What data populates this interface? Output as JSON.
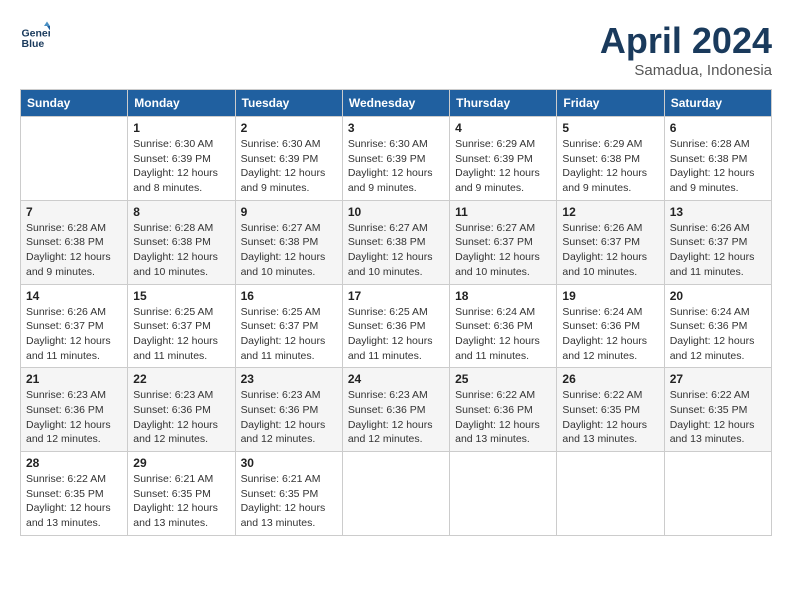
{
  "header": {
    "logo_line1": "General",
    "logo_line2": "Blue",
    "month": "April 2024",
    "location": "Samadua, Indonesia"
  },
  "weekdays": [
    "Sunday",
    "Monday",
    "Tuesday",
    "Wednesday",
    "Thursday",
    "Friday",
    "Saturday"
  ],
  "weeks": [
    [
      {
        "day": "",
        "sunrise": "",
        "sunset": "",
        "daylight": ""
      },
      {
        "day": "1",
        "sunrise": "Sunrise: 6:30 AM",
        "sunset": "Sunset: 6:39 PM",
        "daylight": "Daylight: 12 hours and 8 minutes."
      },
      {
        "day": "2",
        "sunrise": "Sunrise: 6:30 AM",
        "sunset": "Sunset: 6:39 PM",
        "daylight": "Daylight: 12 hours and 9 minutes."
      },
      {
        "day": "3",
        "sunrise": "Sunrise: 6:30 AM",
        "sunset": "Sunset: 6:39 PM",
        "daylight": "Daylight: 12 hours and 9 minutes."
      },
      {
        "day": "4",
        "sunrise": "Sunrise: 6:29 AM",
        "sunset": "Sunset: 6:39 PM",
        "daylight": "Daylight: 12 hours and 9 minutes."
      },
      {
        "day": "5",
        "sunrise": "Sunrise: 6:29 AM",
        "sunset": "Sunset: 6:38 PM",
        "daylight": "Daylight: 12 hours and 9 minutes."
      },
      {
        "day": "6",
        "sunrise": "Sunrise: 6:28 AM",
        "sunset": "Sunset: 6:38 PM",
        "daylight": "Daylight: 12 hours and 9 minutes."
      }
    ],
    [
      {
        "day": "7",
        "sunrise": "Sunrise: 6:28 AM",
        "sunset": "Sunset: 6:38 PM",
        "daylight": "Daylight: 12 hours and 9 minutes."
      },
      {
        "day": "8",
        "sunrise": "Sunrise: 6:28 AM",
        "sunset": "Sunset: 6:38 PM",
        "daylight": "Daylight: 12 hours and 10 minutes."
      },
      {
        "day": "9",
        "sunrise": "Sunrise: 6:27 AM",
        "sunset": "Sunset: 6:38 PM",
        "daylight": "Daylight: 12 hours and 10 minutes."
      },
      {
        "day": "10",
        "sunrise": "Sunrise: 6:27 AM",
        "sunset": "Sunset: 6:38 PM",
        "daylight": "Daylight: 12 hours and 10 minutes."
      },
      {
        "day": "11",
        "sunrise": "Sunrise: 6:27 AM",
        "sunset": "Sunset: 6:37 PM",
        "daylight": "Daylight: 12 hours and 10 minutes."
      },
      {
        "day": "12",
        "sunrise": "Sunrise: 6:26 AM",
        "sunset": "Sunset: 6:37 PM",
        "daylight": "Daylight: 12 hours and 10 minutes."
      },
      {
        "day": "13",
        "sunrise": "Sunrise: 6:26 AM",
        "sunset": "Sunset: 6:37 PM",
        "daylight": "Daylight: 12 hours and 11 minutes."
      }
    ],
    [
      {
        "day": "14",
        "sunrise": "Sunrise: 6:26 AM",
        "sunset": "Sunset: 6:37 PM",
        "daylight": "Daylight: 12 hours and 11 minutes."
      },
      {
        "day": "15",
        "sunrise": "Sunrise: 6:25 AM",
        "sunset": "Sunset: 6:37 PM",
        "daylight": "Daylight: 12 hours and 11 minutes."
      },
      {
        "day": "16",
        "sunrise": "Sunrise: 6:25 AM",
        "sunset": "Sunset: 6:37 PM",
        "daylight": "Daylight: 12 hours and 11 minutes."
      },
      {
        "day": "17",
        "sunrise": "Sunrise: 6:25 AM",
        "sunset": "Sunset: 6:36 PM",
        "daylight": "Daylight: 12 hours and 11 minutes."
      },
      {
        "day": "18",
        "sunrise": "Sunrise: 6:24 AM",
        "sunset": "Sunset: 6:36 PM",
        "daylight": "Daylight: 12 hours and 11 minutes."
      },
      {
        "day": "19",
        "sunrise": "Sunrise: 6:24 AM",
        "sunset": "Sunset: 6:36 PM",
        "daylight": "Daylight: 12 hours and 12 minutes."
      },
      {
        "day": "20",
        "sunrise": "Sunrise: 6:24 AM",
        "sunset": "Sunset: 6:36 PM",
        "daylight": "Daylight: 12 hours and 12 minutes."
      }
    ],
    [
      {
        "day": "21",
        "sunrise": "Sunrise: 6:23 AM",
        "sunset": "Sunset: 6:36 PM",
        "daylight": "Daylight: 12 hours and 12 minutes."
      },
      {
        "day": "22",
        "sunrise": "Sunrise: 6:23 AM",
        "sunset": "Sunset: 6:36 PM",
        "daylight": "Daylight: 12 hours and 12 minutes."
      },
      {
        "day": "23",
        "sunrise": "Sunrise: 6:23 AM",
        "sunset": "Sunset: 6:36 PM",
        "daylight": "Daylight: 12 hours and 12 minutes."
      },
      {
        "day": "24",
        "sunrise": "Sunrise: 6:23 AM",
        "sunset": "Sunset: 6:36 PM",
        "daylight": "Daylight: 12 hours and 12 minutes."
      },
      {
        "day": "25",
        "sunrise": "Sunrise: 6:22 AM",
        "sunset": "Sunset: 6:36 PM",
        "daylight": "Daylight: 12 hours and 13 minutes."
      },
      {
        "day": "26",
        "sunrise": "Sunrise: 6:22 AM",
        "sunset": "Sunset: 6:35 PM",
        "daylight": "Daylight: 12 hours and 13 minutes."
      },
      {
        "day": "27",
        "sunrise": "Sunrise: 6:22 AM",
        "sunset": "Sunset: 6:35 PM",
        "daylight": "Daylight: 12 hours and 13 minutes."
      }
    ],
    [
      {
        "day": "28",
        "sunrise": "Sunrise: 6:22 AM",
        "sunset": "Sunset: 6:35 PM",
        "daylight": "Daylight: 12 hours and 13 minutes."
      },
      {
        "day": "29",
        "sunrise": "Sunrise: 6:21 AM",
        "sunset": "Sunset: 6:35 PM",
        "daylight": "Daylight: 12 hours and 13 minutes."
      },
      {
        "day": "30",
        "sunrise": "Sunrise: 6:21 AM",
        "sunset": "Sunset: 6:35 PM",
        "daylight": "Daylight: 12 hours and 13 minutes."
      },
      {
        "day": "",
        "sunrise": "",
        "sunset": "",
        "daylight": ""
      },
      {
        "day": "",
        "sunrise": "",
        "sunset": "",
        "daylight": ""
      },
      {
        "day": "",
        "sunrise": "",
        "sunset": "",
        "daylight": ""
      },
      {
        "day": "",
        "sunrise": "",
        "sunset": "",
        "daylight": ""
      }
    ]
  ]
}
